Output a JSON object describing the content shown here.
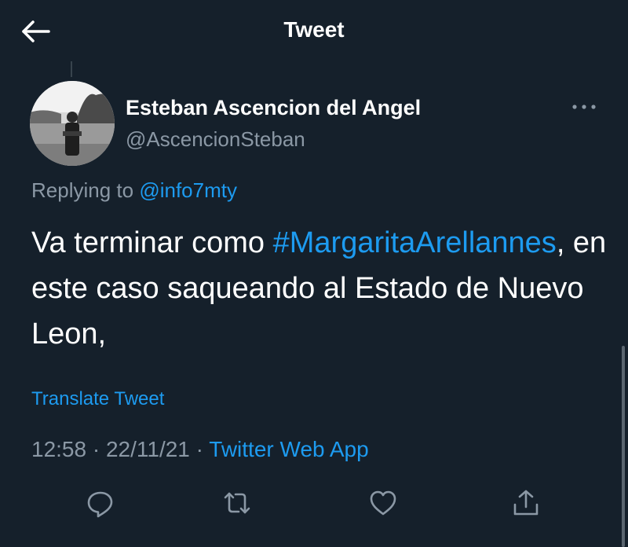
{
  "header": {
    "title": "Tweet",
    "back_icon": "arrow-left-icon"
  },
  "tweet": {
    "author": {
      "display_name": "Esteban Ascencion del Angel",
      "handle": "@AscencionSteban"
    },
    "replying_prefix": "Replying to ",
    "replying_to": "@info7mty",
    "text_before": "Va terminar como ",
    "hashtag": "#MargaritaArellannes",
    "text_after": ", en este caso saqueando al Estado de Nuevo Leon,",
    "translate_label": "Translate Tweet",
    "time": "12:58",
    "separator": " · ",
    "date": "22/11/21",
    "source": "Twitter Web App"
  },
  "actions": [
    {
      "icon": "reply-icon"
    },
    {
      "icon": "retweet-icon"
    },
    {
      "icon": "like-icon"
    },
    {
      "icon": "share-icon"
    }
  ],
  "colors": {
    "background": "#15202b",
    "accent": "#1d9bf0",
    "secondary_text": "#8b98a5",
    "primary_text": "#ffffff"
  }
}
